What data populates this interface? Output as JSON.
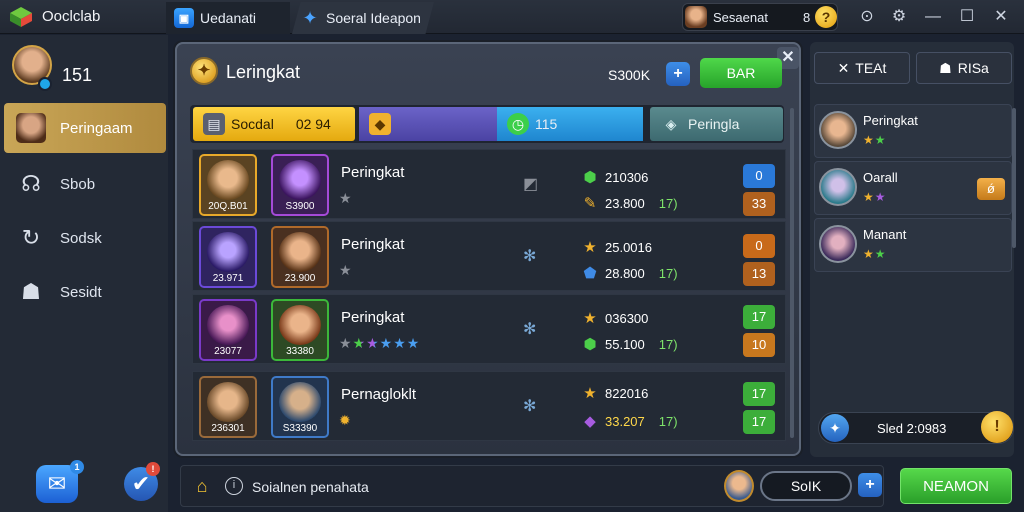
{
  "titlebar": {
    "app_title": "Ooclclab",
    "tabs": [
      {
        "label": "Uedanati",
        "icon": "app-store-icon"
      },
      {
        "label": "Soeral Ideapon",
        "icon": "star-icon"
      }
    ],
    "user": {
      "name": "Sesaenat",
      "level": "8",
      "coin_glyph": "?"
    },
    "controls": {
      "minimize": "—",
      "maximize": "☐",
      "close": "✕"
    }
  },
  "sidebar": {
    "profile_number": "151",
    "items": [
      {
        "label": "Peringaam",
        "icon": "hero-portrait-icon",
        "active": true
      },
      {
        "label": "Sbob",
        "icon": "headset-icon",
        "active": false
      },
      {
        "label": "Sodsk",
        "icon": "cycle-icon",
        "active": false
      },
      {
        "label": "Sesidt",
        "icon": "group-icon",
        "active": false
      }
    ],
    "bottom_buttons": [
      {
        "icon": "chat-icon",
        "badge": "1"
      },
      {
        "icon": "shield-check-icon",
        "badge": "!"
      }
    ]
  },
  "panel": {
    "title": "Leringkat",
    "score": "S300K",
    "green_button": "BAR",
    "filters": [
      {
        "label": "Socdal",
        "value": "02 94"
      },
      {
        "label": "",
        "value": ""
      },
      {
        "label": "115",
        "value": ""
      },
      {
        "label": "Peringla",
        "value": ""
      }
    ],
    "rows": [
      {
        "cards": [
          {
            "caption": "20Q.B01"
          },
          {
            "caption": "S3900"
          }
        ],
        "name": "Peringkat",
        "stars": "★",
        "stat1": {
          "text": "210306"
        },
        "stat2": {
          "text": "23.800",
          "green": "17)"
        },
        "badge_top": "0",
        "badge_bottom": "33"
      },
      {
        "cards": [
          {
            "caption": "23.971"
          },
          {
            "caption": "23.900"
          }
        ],
        "name": "Peringkat",
        "stars": "★",
        "stat1": {
          "text": "25.0016"
        },
        "stat2": {
          "text": "28.800",
          "green": "17)"
        },
        "badge_top": "0",
        "badge_bottom": "13"
      },
      {
        "cards": [
          {
            "caption": "23077"
          },
          {
            "caption": "33380"
          }
        ],
        "name": "Peringkat",
        "stars": "★★★★★★",
        "stat1": {
          "text": "036300"
        },
        "stat2": {
          "text": "55.100",
          "green": "17)"
        },
        "badge_top": "17",
        "badge_bottom": "10"
      },
      {
        "cards": [
          {
            "caption": "236301"
          },
          {
            "caption": "S33390"
          }
        ],
        "name": "Pernagloklt",
        "stars": "",
        "stat1": {
          "text": "822016"
        },
        "stat2": {
          "text": "33.207",
          "green": "17)"
        },
        "badge_top": "17",
        "badge_bottom": "17"
      }
    ]
  },
  "bottombar": {
    "info_text": "Soialnen penahata",
    "pill_button": "SoIK",
    "main_button": "NEAMON"
  },
  "right_panel": {
    "tabs": [
      "TEAt",
      "RISa"
    ],
    "items": [
      {
        "name": "Peringkat",
        "stars": "★★"
      },
      {
        "name": "Oarall",
        "stars": "★★",
        "badge": "ǿ"
      },
      {
        "name": "Manant",
        "stars": "★★"
      }
    ],
    "footer_text": "Sled 2:0983",
    "footer_coin": "!"
  },
  "colors": {
    "accent_gold": "#c9a657",
    "green": "#3cc23a",
    "blue": "#2f7be0",
    "orange": "#e0861e"
  }
}
